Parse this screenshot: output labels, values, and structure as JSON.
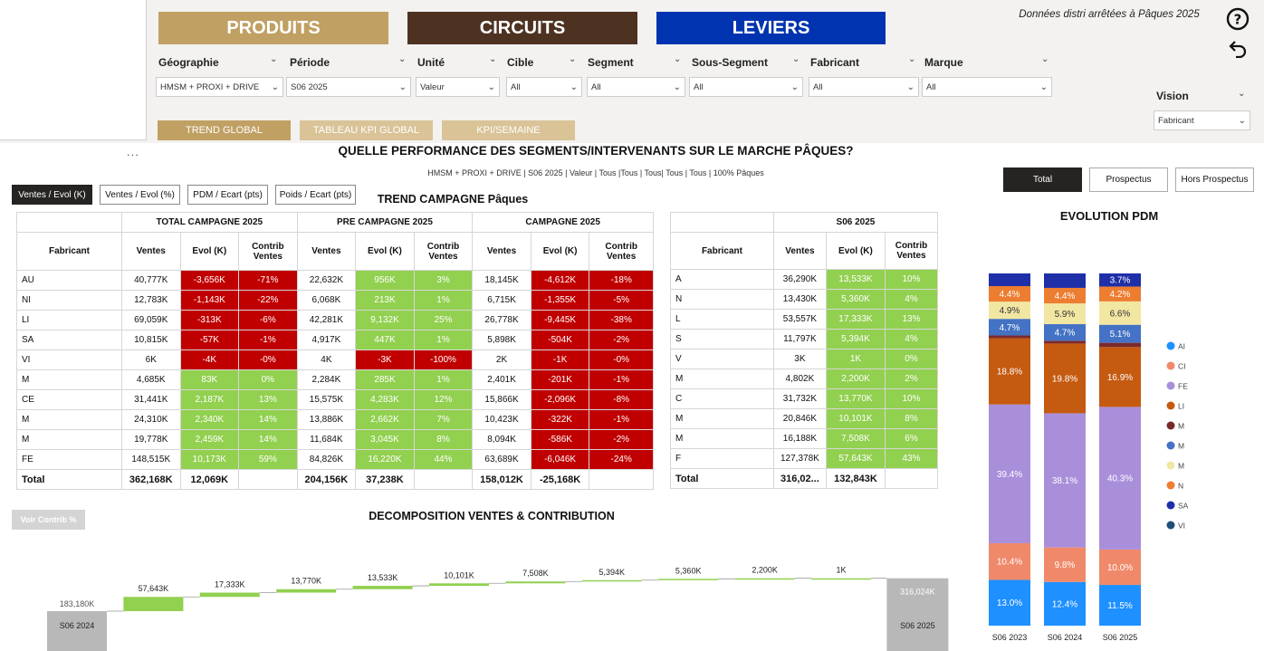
{
  "nav": {
    "produits": "PRODUITS",
    "circuits": "CIRCUITS",
    "leviers": "LEVIERS"
  },
  "note": "Données distri arrêtées à Pâques 2025",
  "icons": {
    "help": "help-icon",
    "back": "back-arrow-icon"
  },
  "filters": [
    {
      "label": "Géographie",
      "value": "HMSM + PROXI + DRIVE"
    },
    {
      "label": "Période",
      "value": "S06 2025"
    },
    {
      "label": "Unité",
      "value": "Valeur"
    },
    {
      "label": "Cible",
      "value": "All"
    },
    {
      "label": "Segment",
      "value": "All"
    },
    {
      "label": "Sous-Segment",
      "value": "All"
    },
    {
      "label": "Fabricant",
      "value": "All"
    },
    {
      "label": "Marque",
      "value": "All"
    }
  ],
  "vision": {
    "label": "Vision",
    "value": "Fabricant"
  },
  "tabs": [
    "TREND GLOBAL",
    "TABLEAU KPI GLOBAL",
    "KPI/SEMAINE"
  ],
  "more": "...",
  "page_title": "QUELLE PERFORMANCE DES SEGMENTS/INTERVENANTS SUR LE MARCHE PÂQUES?",
  "subtitle": "HMSM + PROXI + DRIVE | S06 2025 | Valeur | Tous |Tous | Tous| Tous | Tous | 100% Pâques",
  "view_buttons": [
    "Ventes / Evol (K)",
    "Ventes / Evol (%)",
    "PDM / Ecart (pts)",
    "Poids / Ecart (pts)"
  ],
  "toggle_buttons": [
    "Total",
    "Prospectus",
    "Hors Prospectus"
  ],
  "trend": {
    "title": "TREND CAMPAGNE Pâques",
    "groups": [
      "TOTAL CAMPAGNE 2025",
      "PRE CAMPAGNE 2025",
      "CAMPAGNE 2025"
    ],
    "col_fab": "Fabricant",
    "cols": [
      "Ventes",
      "Evol (K)",
      "Contrib Ventes"
    ],
    "rows": [
      {
        "fab": "AU",
        "v": [
          "40,777K",
          "-3,656K",
          "-71%",
          "22,632K",
          "956K",
          "3%",
          "18,145K",
          "-4,612K",
          "-18%"
        ],
        "c": [
          "r",
          "r",
          "g",
          "g",
          "r",
          "r"
        ]
      },
      {
        "fab": "NI",
        "v": [
          "12,783K",
          "-1,143K",
          "-22%",
          "6,068K",
          "213K",
          "1%",
          "6,715K",
          "-1,355K",
          "-5%"
        ],
        "c": [
          "r",
          "r",
          "g",
          "g",
          "r",
          "r"
        ]
      },
      {
        "fab": "LI",
        "v": [
          "69,059K",
          "-313K",
          "-6%",
          "42,281K",
          "9,132K",
          "25%",
          "26,778K",
          "-9,445K",
          "-38%"
        ],
        "c": [
          "r",
          "r",
          "g",
          "g",
          "r",
          "r"
        ]
      },
      {
        "fab": "SA",
        "v": [
          "10,815K",
          "-57K",
          "-1%",
          "4,917K",
          "447K",
          "1%",
          "5,898K",
          "-504K",
          "-2%"
        ],
        "c": [
          "r",
          "r",
          "g",
          "g",
          "r",
          "r"
        ]
      },
      {
        "fab": "VI",
        "v": [
          "6K",
          "-4K",
          "-0%",
          "4K",
          "-3K",
          "-100%",
          "2K",
          "-1K",
          "-0%"
        ],
        "c": [
          "r",
          "r",
          "r",
          "r",
          "r",
          "r"
        ]
      },
      {
        "fab": "M",
        "v": [
          "4,685K",
          "83K",
          "0%",
          "2,284K",
          "285K",
          "1%",
          "2,401K",
          "-201K",
          "-1%"
        ],
        "c": [
          "g",
          "g",
          "g",
          "g",
          "r",
          "r"
        ]
      },
      {
        "fab": "CE",
        "v": [
          "31,441K",
          "2,187K",
          "13%",
          "15,575K",
          "4,283K",
          "12%",
          "15,866K",
          "-2,096K",
          "-8%"
        ],
        "c": [
          "g",
          "g",
          "g",
          "g",
          "r",
          "r"
        ]
      },
      {
        "fab": "M",
        "v": [
          "24,310K",
          "2,340K",
          "14%",
          "13,886K",
          "2,662K",
          "7%",
          "10,423K",
          "-322K",
          "-1%"
        ],
        "c": [
          "g",
          "g",
          "g",
          "g",
          "r",
          "r"
        ]
      },
      {
        "fab": "M",
        "v": [
          "19,778K",
          "2,459K",
          "14%",
          "11,684K",
          "3,045K",
          "8%",
          "8,094K",
          "-586K",
          "-2%"
        ],
        "c": [
          "g",
          "g",
          "g",
          "g",
          "r",
          "r"
        ]
      },
      {
        "fab": "FE",
        "v": [
          "148,515K",
          "10,173K",
          "59%",
          "84,826K",
          "16,220K",
          "44%",
          "63,689K",
          "-6,046K",
          "-24%"
        ],
        "c": [
          "g",
          "g",
          "g",
          "g",
          "r",
          "r"
        ]
      }
    ],
    "total": {
      "label": "Total",
      "v": [
        "362,168K",
        "12,069K",
        "",
        "204,156K",
        "37,238K",
        "",
        "158,012K",
        "-25,168K",
        ""
      ]
    }
  },
  "s06": {
    "group": "S06 2025",
    "col_fab": "Fabricant",
    "cols": [
      "Ventes",
      "Evol (K)",
      "Contrib Ventes"
    ],
    "rows": [
      {
        "fab": "A",
        "v": [
          "36,290K",
          "13,533K",
          "10%"
        ]
      },
      {
        "fab": "N",
        "v": [
          "13,430K",
          "5,360K",
          "4%"
        ]
      },
      {
        "fab": "L",
        "v": [
          "53,557K",
          "17,333K",
          "13%"
        ]
      },
      {
        "fab": "S",
        "v": [
          "11,797K",
          "5,394K",
          "4%"
        ]
      },
      {
        "fab": "V",
        "v": [
          "3K",
          "1K",
          "0%"
        ]
      },
      {
        "fab": "M",
        "v": [
          "4,802K",
          "2,200K",
          "2%"
        ]
      },
      {
        "fab": "C",
        "v": [
          "31,732K",
          "13,770K",
          "10%"
        ]
      },
      {
        "fab": "M",
        "v": [
          "20,846K",
          "10,101K",
          "8%"
        ]
      },
      {
        "fab": "M",
        "v": [
          "16,188K",
          "7,508K",
          "6%"
        ]
      },
      {
        "fab": "F",
        "v": [
          "127,378K",
          "57,643K",
          "43%"
        ]
      }
    ],
    "total": {
      "label": "Total",
      "v": [
        "316,02...",
        "132,843K",
        ""
      ]
    }
  },
  "voir_contrib": "Voir Contrib %",
  "chart_data": [
    {
      "type": "waterfall",
      "title": "DECOMPOSITION VENTES & CONTRIBUTION",
      "start": {
        "label": "S06 2024",
        "value": 183180,
        "text": "183,180K"
      },
      "steps": [
        {
          "value": 57643,
          "text": "57,643K"
        },
        {
          "value": 17333,
          "text": "17,333K"
        },
        {
          "value": 13770,
          "text": "13,770K"
        },
        {
          "value": 13533,
          "text": "13,533K"
        },
        {
          "value": 10101,
          "text": "10,101K"
        },
        {
          "value": 7508,
          "text": "7,508K"
        },
        {
          "value": 5394,
          "text": "5,394K"
        },
        {
          "value": 5360,
          "text": "5,360K"
        },
        {
          "value": 2200,
          "text": "2,200K"
        },
        {
          "value": 1,
          "text": "1K"
        }
      ],
      "end": {
        "label": "S06 2025",
        "value": 316024,
        "text": "316,024K"
      }
    },
    {
      "type": "stacked-bar-100",
      "title": "EVOLUTION PDM",
      "categories": [
        "S06 2023",
        "S06 2024",
        "S06 2025"
      ],
      "series": [
        {
          "color": "#1e90ff",
          "values": [
            13.0,
            12.4,
            11.5
          ],
          "labels": [
            "13.0%",
            "12.4%",
            "11.5%"
          ]
        },
        {
          "color": "#f0896a",
          "values": [
            10.4,
            9.8,
            10.0
          ],
          "labels": [
            "10.4%",
            "9.8%",
            "10.0%"
          ]
        },
        {
          "color": "#a98fda",
          "values": [
            39.4,
            38.1,
            40.3
          ],
          "labels": [
            "39.4%",
            "38.1%",
            "40.3%"
          ]
        },
        {
          "color": "#c55a11",
          "values": [
            18.8,
            19.8,
            16.9
          ],
          "labels": [
            "18.8%",
            "19.8%",
            "16.9%"
          ]
        },
        {
          "color": "#7b2a2a",
          "values": [
            0.8,
            0.8,
            1.2
          ],
          "labels": [
            "",
            "",
            ""
          ]
        },
        {
          "color": "#4472c4",
          "values": [
            4.7,
            4.7,
            5.1
          ],
          "labels": [
            "4.7%",
            "4.7%",
            "5.1%"
          ]
        },
        {
          "color": "#f2e6a3",
          "values": [
            4.9,
            5.9,
            6.6
          ],
          "labels": [
            "4.9%",
            "5.9%",
            "6.6%"
          ]
        },
        {
          "color": "#ed7d31",
          "values": [
            4.4,
            4.4,
            4.2
          ],
          "labels": [
            "4.4%",
            "4.4%",
            "4.2%"
          ]
        },
        {
          "color": "#1f2fa8",
          "values": [
            3.6,
            4.1,
            3.7
          ],
          "labels": [
            "",
            "",
            "3.7%"
          ]
        },
        {
          "color": "#1f4e79",
          "values": [
            0.0,
            0.0,
            0.0
          ],
          "labels": [
            "",
            "",
            ""
          ]
        }
      ],
      "legend": [
        {
          "label": "AI",
          "color": "#1e90ff"
        },
        {
          "label": "CI",
          "color": "#f0896a"
        },
        {
          "label": "FE",
          "color": "#a98fda"
        },
        {
          "label": "LI",
          "color": "#c55a11"
        },
        {
          "label": "M",
          "color": "#7b2a2a"
        },
        {
          "label": "M",
          "color": "#4472c4"
        },
        {
          "label": "M",
          "color": "#f2e6a3"
        },
        {
          "label": "N",
          "color": "#ed7d31"
        },
        {
          "label": "SA",
          "color": "#1f2fa8"
        },
        {
          "label": "VI",
          "color": "#1f4e79"
        }
      ]
    }
  ]
}
